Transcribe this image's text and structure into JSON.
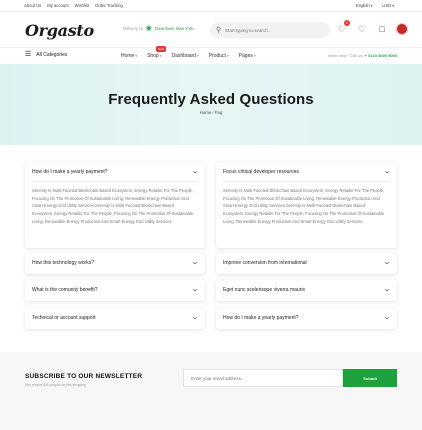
{
  "topbar": {
    "links": [
      "About Us",
      "My account",
      "Wishlist",
      "Order Tracking"
    ],
    "language": "English",
    "currency": "USD"
  },
  "header": {
    "logo": "Orgasto",
    "deliver_label": "Delivery to",
    "deliver_city": "Downtown New York...",
    "search_placeholder": "Start typing to search...",
    "notification_count": "2"
  },
  "nav": {
    "all_categories": "All Categories",
    "menu": [
      "Home",
      "Shop",
      "Dashboard",
      "Product",
      "Pages"
    ],
    "shop_badge": "New",
    "help_label": "Need help? Call Us:",
    "help_phone": "+ 0123 4000 5000"
  },
  "hero": {
    "title": "Frequently Asked Questions",
    "breadcrumb": "Home / Faq"
  },
  "faq": {
    "left": [
      {
        "question": "How do I make a yearly payment?",
        "answer": "Serenity Is Multi-Faceted Blockchain Based Ecosystem, Energy Retailer For The People, Focusing On The Promotion Of Sustainable Living, Renewable Energy Production And Smart Energy Grid Utility Services Serenity Is Multi-Faceted Blockchain Based Ecosystem, Energy Retailer For The People, Focusing On The Promotion Of Sustainable Living, Renewable Energy Production And Smart Energy Grid Utility Services."
      },
      {
        "question": "How this technology works?"
      },
      {
        "question": "What is the comunity benefit?"
      },
      {
        "question": "Technical or account support"
      }
    ],
    "right": [
      {
        "question": "Focus critical developer resources",
        "answer": "Serenity Is Multi-Faceted Blockchain Based Ecosystem, Energy Retailer For The People, Focusing On The Promotion Of Sustainable Living, Renewable Energy Production And Smart Energy Grid Utility Services Serenity Is Multi-Faceted Blockchain Based Ecosystem, Energy Retailer For The People, Focusing On The Promotion Of Sustainable Living, Renewable Energy Production And Smart Energy Grid Utility Services."
      },
      {
        "question": "Improve conversion from international"
      },
      {
        "question": "Eget nunc scelerisque viverra mauris"
      },
      {
        "question": "How do I make a yearly payment?"
      }
    ]
  },
  "newsletter": {
    "title": "SUBSCRIBE TO OUR NEWSLETTER",
    "subtitle": "And receive $20 coupon for first shopping",
    "email_placeholder": "Enter your email address...",
    "button": "Submit"
  },
  "colors": {
    "accent_green": "#1ea03c",
    "badge_red": "#e53935",
    "hero_bg": "#dff3f2"
  }
}
